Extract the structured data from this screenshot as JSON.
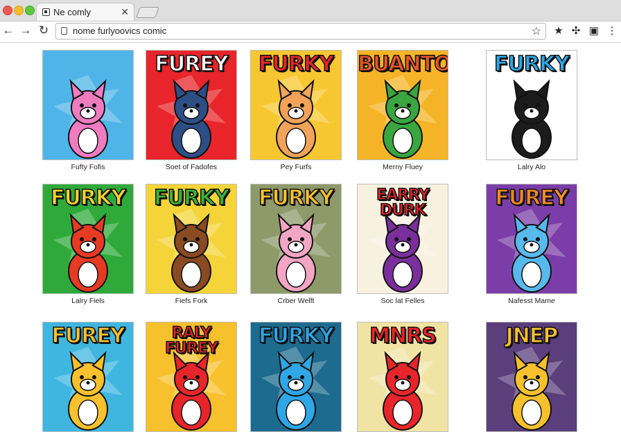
{
  "window": {
    "tab": {
      "title": "Ne comly",
      "close_icon": "close-icon",
      "favicon": "page-icon"
    },
    "toolbar": {
      "back_icon": "back-arrow-icon",
      "forward_icon": "forward-arrow-icon",
      "reload_icon": "reload-icon",
      "url": "nome furlyoovics comic",
      "bookmark_icon": "star-icon",
      "extension_icons": [
        "star-icon",
        "puzzle-icon",
        "save-icon",
        "menu-icon"
      ]
    }
  },
  "gallery": {
    "cards": [
      {
        "headline": "",
        "caption": "Fufty Fofis",
        "bg": "#4fb5e8",
        "accent": "#f07cc0",
        "headline_color": "#ffffff"
      },
      {
        "headline": "FUREY",
        "caption": "Soet of Fadofes",
        "bg": "#e8252a",
        "accent": "#2d4f86",
        "headline_color": "#ffffff"
      },
      {
        "headline": "FURKY",
        "caption": "Pey Furfs",
        "bg": "#f7c731",
        "accent": "#f1a35a",
        "headline_color": "#e8252a"
      },
      {
        "headline": "BUANTOY",
        "caption": "Merny Fluey",
        "bg": "#f5b427",
        "accent": "#3aa640",
        "headline_color": "#e8552a"
      },
      {
        "headline": "FURKY",
        "caption": "Lalry Alo",
        "bg": "#ffffff",
        "accent": "#1c1c1c",
        "headline_color": "#2fa6e6"
      },
      {
        "headline": "FURKY",
        "caption": "Lalry Fiels",
        "bg": "#2faa3a",
        "accent": "#e63a24",
        "headline_color": "#f7d22e"
      },
      {
        "headline": "FURKY",
        "caption": "Fiefs Fork",
        "bg": "#f4d438",
        "accent": "#8a4a22",
        "headline_color": "#3fb23a"
      },
      {
        "headline": "FURKY",
        "caption": "Crber Welft",
        "bg": "#8e9a6a",
        "accent": "#f3a6c3",
        "headline_color": "#f7c12e"
      },
      {
        "headline": "EARRY DURK",
        "caption": "Soc lat Felles",
        "bg": "#f8f1e0",
        "accent": "#7a2f9c",
        "headline_color": "#e8252a"
      },
      {
        "headline": "FUREY",
        "caption": "Nafesst Mame",
        "bg": "#7b3ea8",
        "accent": "#58b9ec",
        "headline_color": "#f08a25"
      },
      {
        "headline": "FUREY",
        "caption": "",
        "bg": "#3eb6e0",
        "accent": "#f7c12e",
        "headline_color": "#f7c12e"
      },
      {
        "headline": "RALY FUREY",
        "caption": "",
        "bg": "#f7c12e",
        "accent": "#e8252a",
        "headline_color": "#e8252a"
      },
      {
        "headline": "FURKY",
        "caption": "",
        "bg": "#1d6b8e",
        "accent": "#2fa6e6",
        "headline_color": "#2fa6e6"
      },
      {
        "headline": "MNRS",
        "caption": "",
        "bg": "#f1e3a4",
        "accent": "#e8252a",
        "headline_color": "#e8252a"
      },
      {
        "headline": "JNEP",
        "caption": "",
        "bg": "#5b3e7c",
        "accent": "#f7c12e",
        "headline_color": "#f7c12e"
      }
    ]
  }
}
